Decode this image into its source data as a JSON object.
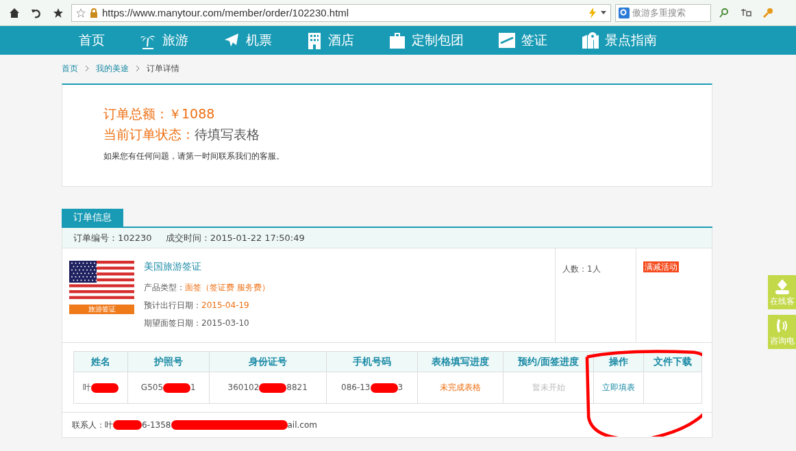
{
  "browser": {
    "url": "https://www.manytour.com/member/order/102230.html",
    "search_placeholder": "傲游多重搜索"
  },
  "nav": [
    {
      "label": "首页"
    },
    {
      "label": "旅游"
    },
    {
      "label": "机票"
    },
    {
      "label": "酒店"
    },
    {
      "label": "定制包团"
    },
    {
      "label": "签证"
    },
    {
      "label": "景点指南"
    }
  ],
  "breadcrumb": [
    {
      "label": "首页",
      "link": true
    },
    {
      "label": "我的美途",
      "link": true
    },
    {
      "label": "订单详情",
      "link": false
    }
  ],
  "summary": {
    "total_label": "订单总额：",
    "total_value": "￥1088",
    "status_label": "当前订单状态：",
    "status_value": "待填写表格",
    "note": "如果您有任何问题，请第一时间联系我们的客服。"
  },
  "section_tab": "订单信息",
  "order_line": {
    "number": "订单编号：102230",
    "time": "成交时间：2015-01-22 17:50:49"
  },
  "product": {
    "flag_caption": "旅游签证",
    "title": "美国旅游签证",
    "fields": [
      {
        "label": "产品类型：",
        "value": "面签（签证费 服务费）",
        "highlight": true
      },
      {
        "label": "预计出行日期：",
        "value": "2015-04-19",
        "highlight": true
      },
      {
        "label": "期望面签日期：",
        "value": "2015-03-10",
        "highlight": false
      }
    ],
    "people_label": "人数：",
    "people_value": "1人",
    "promo": "满减活动"
  },
  "table": {
    "columns": [
      "姓名",
      "护照号",
      "身份证号",
      "手机号码",
      "表格填写进度",
      "预约/面签进度",
      "操作",
      "文件下载"
    ],
    "rows": [
      [
        {
          "kind": "redacted",
          "parts": [
            "叶"
          ]
        },
        {
          "kind": "redacted",
          "parts": [
            "G505",
            "1"
          ]
        },
        {
          "kind": "redacted",
          "parts": [
            "360102",
            "8821"
          ]
        },
        {
          "kind": "redacted",
          "parts": [
            "086-13",
            "3"
          ]
        },
        {
          "kind": "status",
          "parts": [
            "未完成表格"
          ]
        },
        {
          "kind": "muted",
          "parts": [
            "暂未开始"
          ]
        },
        {
          "kind": "link",
          "parts": [
            "立即填表"
          ]
        },
        {
          "kind": "empty"
        }
      ]
    ]
  },
  "contact": {
    "label": "联系人：",
    "parts": [
      "叶",
      "6-1358",
      "ail.com"
    ]
  },
  "side_buttons": [
    {
      "label": "在线客"
    },
    {
      "label": "咨询电"
    }
  ]
}
